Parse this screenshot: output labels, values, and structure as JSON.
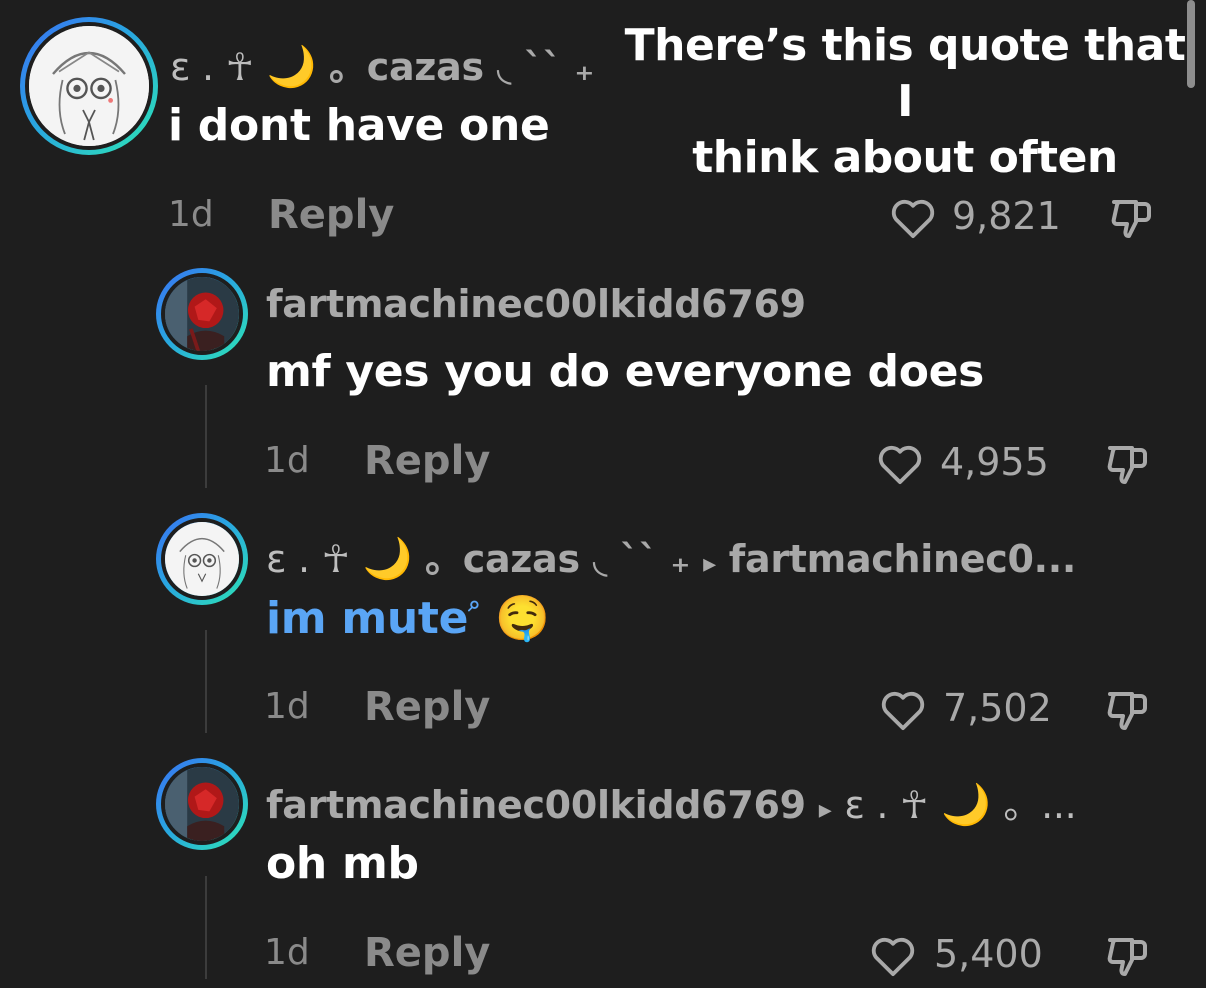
{
  "overlay": {
    "caption_line1": "There’s this quote that I",
    "caption_line2": "think about often"
  },
  "comments": [
    {
      "username_prefix": "ɛ . ☥",
      "username_moon": "🌙",
      "username_name": "。cazas ◟ `` ₊",
      "text": "i dont have one",
      "time": "1d",
      "reply_label": "Reply",
      "likes": "9,821"
    },
    {
      "username": "fartmachinec00lkidd6769",
      "text": "mf yes you do everyone does",
      "time": "1d",
      "reply_label": "Reply",
      "likes": "4,955"
    },
    {
      "username_prefix": "ɛ . ☥",
      "username_moon": "🌙",
      "username_name": "。cazas ◟ `` ₊",
      "reply_arrow": "▸",
      "reply_to": "fartmachinec0...",
      "text": "im mute",
      "text_emoji": "🤤",
      "time": "1d",
      "reply_label": "Reply",
      "likes": "7,502"
    },
    {
      "username": "fartmachinec00lkidd6769",
      "reply_arrow": "▸",
      "reply_to_prefix": "ɛ . ☥",
      "reply_to_moon": "🌙",
      "reply_to_suffix": "。...",
      "text": "oh mb",
      "time": "1d",
      "reply_label": "Reply",
      "likes": "5,400"
    }
  ],
  "icons": {
    "like": "heart-outline-icon",
    "dislike": "thumbs-down-icon",
    "mute_search": "search-icon"
  },
  "colors": {
    "background": "#1e1e1e",
    "mention_blue": "#5aa5f5",
    "ring_start": "#3b6ff5",
    "ring_end": "#2ee6b4"
  }
}
